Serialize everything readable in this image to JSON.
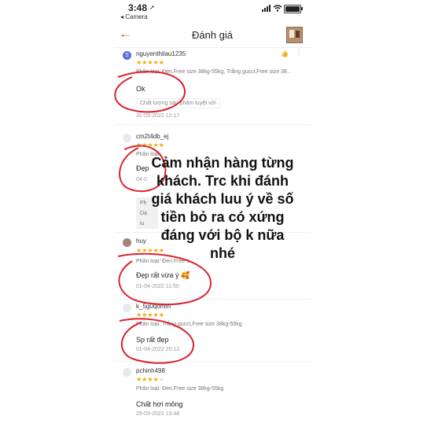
{
  "status": {
    "time": "3:48",
    "back_app": "◂ Camera"
  },
  "header": {
    "title": "Đánh giá"
  },
  "reviews": [
    {
      "user": "nguyenthilau1235",
      "avatar_letter": "S",
      "stars": 5,
      "stars_text": "★★★★★",
      "variant": "Phân loại: Đen,Free size 38kg-55kg, Trắng gucci,Free size 38...",
      "comment": "Ok",
      "tag": "Chất lượng sản phẩm tuyệt vời",
      "date": "31-03-2022 12:17"
    },
    {
      "user": "cm2t4db_ej",
      "stars": 5,
      "stars_text": "★★★★★",
      "variant": "Phân loại:",
      "comment": "Đẹp",
      "date": "04-0",
      "box_lines": [
        "Ph",
        "Dạ",
        "iu"
      ]
    },
    {
      "user": "huy",
      "stars": 5,
      "stars_text": "★★★★★",
      "variant": "Phân loại: Đen,Free s",
      "comment": "Đẹp rất vừa ý 🥰",
      "date": "01-04-2022 11:50"
    },
    {
      "user": "k_5g0qomm",
      "stars": 5,
      "stars_text": "★★★★★",
      "variant": "Phân loại: Trắng gucci,Free size 38kg-55kg",
      "comment": "Sp rất đẹp",
      "date": "01-04-2022 20:12"
    },
    {
      "user": "pchinh498",
      "stars": 4,
      "stars_text": "★★★★",
      "stars_off": "★",
      "variant": "Phân loại: Đen,Free size 38kg-55kg",
      "comment": "Chất hơi mỏng",
      "date": "29-03-2022 13:48"
    }
  ],
  "overlay": {
    "text": "Cảm nhận hàng từng khách. Trc khi đánh giá khách luu ý về số tiền bỏ ra có xứng đáng với bộ k nữa nhé"
  },
  "colors": {
    "accent": "#ee4d2d",
    "star": "#f6a700",
    "annotation": "#d9232e"
  },
  "icons": [
    "back-arrow-icon",
    "thumbs-up-icon",
    "more-icon",
    "signal-icon",
    "wifi-icon",
    "battery-icon"
  ]
}
